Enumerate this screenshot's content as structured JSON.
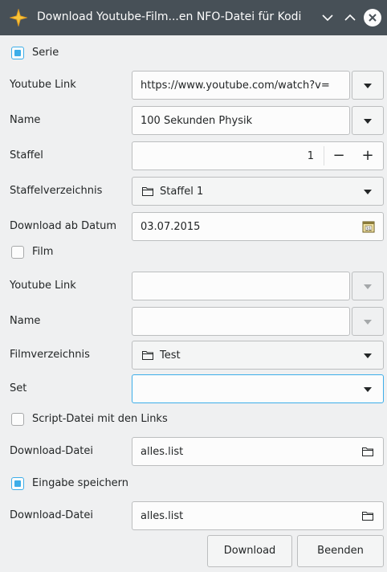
{
  "window": {
    "title": "Download Youtube-Film...en NFO-Datei für Kodi"
  },
  "serie": {
    "checkbox_label": "Serie",
    "checked": true,
    "youtube_link_label": "Youtube Link",
    "youtube_link_value": "https://www.youtube.com/watch?v=",
    "name_label": "Name",
    "name_value": "100 Sekunden Physik",
    "staffel_label": "Staffel",
    "staffel_value": "1",
    "minus": "−",
    "plus": "+",
    "staffelverzeichnis_label": "Staffelverzeichnis",
    "staffelverzeichnis_value": "Staffel 1",
    "download_ab_label": "Download ab Datum",
    "download_ab_value": "03.07.2015"
  },
  "film": {
    "checkbox_label": "Film",
    "checked": false,
    "youtube_link_label": "Youtube Link",
    "youtube_link_value": "",
    "name_label": "Name",
    "name_value": "",
    "filmverzeichnis_label": "Filmverzeichnis",
    "filmverzeichnis_value": "Test",
    "set_label": "Set",
    "set_value": ""
  },
  "script": {
    "checkbox_label": "Script-Datei mit den Links",
    "checked": false,
    "download_datei_label": "Download-Datei",
    "download_datei_value": "alles.list"
  },
  "save": {
    "checkbox_label": "Eingabe speichern",
    "checked": true,
    "download_datei_label": "Download-Datei",
    "download_datei_value": "alles.list"
  },
  "buttons": {
    "download": "Download",
    "beenden": "Beenden"
  },
  "colors": {
    "accent": "#3daee9",
    "titlebar": "#475057",
    "background": "#eff0f1"
  }
}
